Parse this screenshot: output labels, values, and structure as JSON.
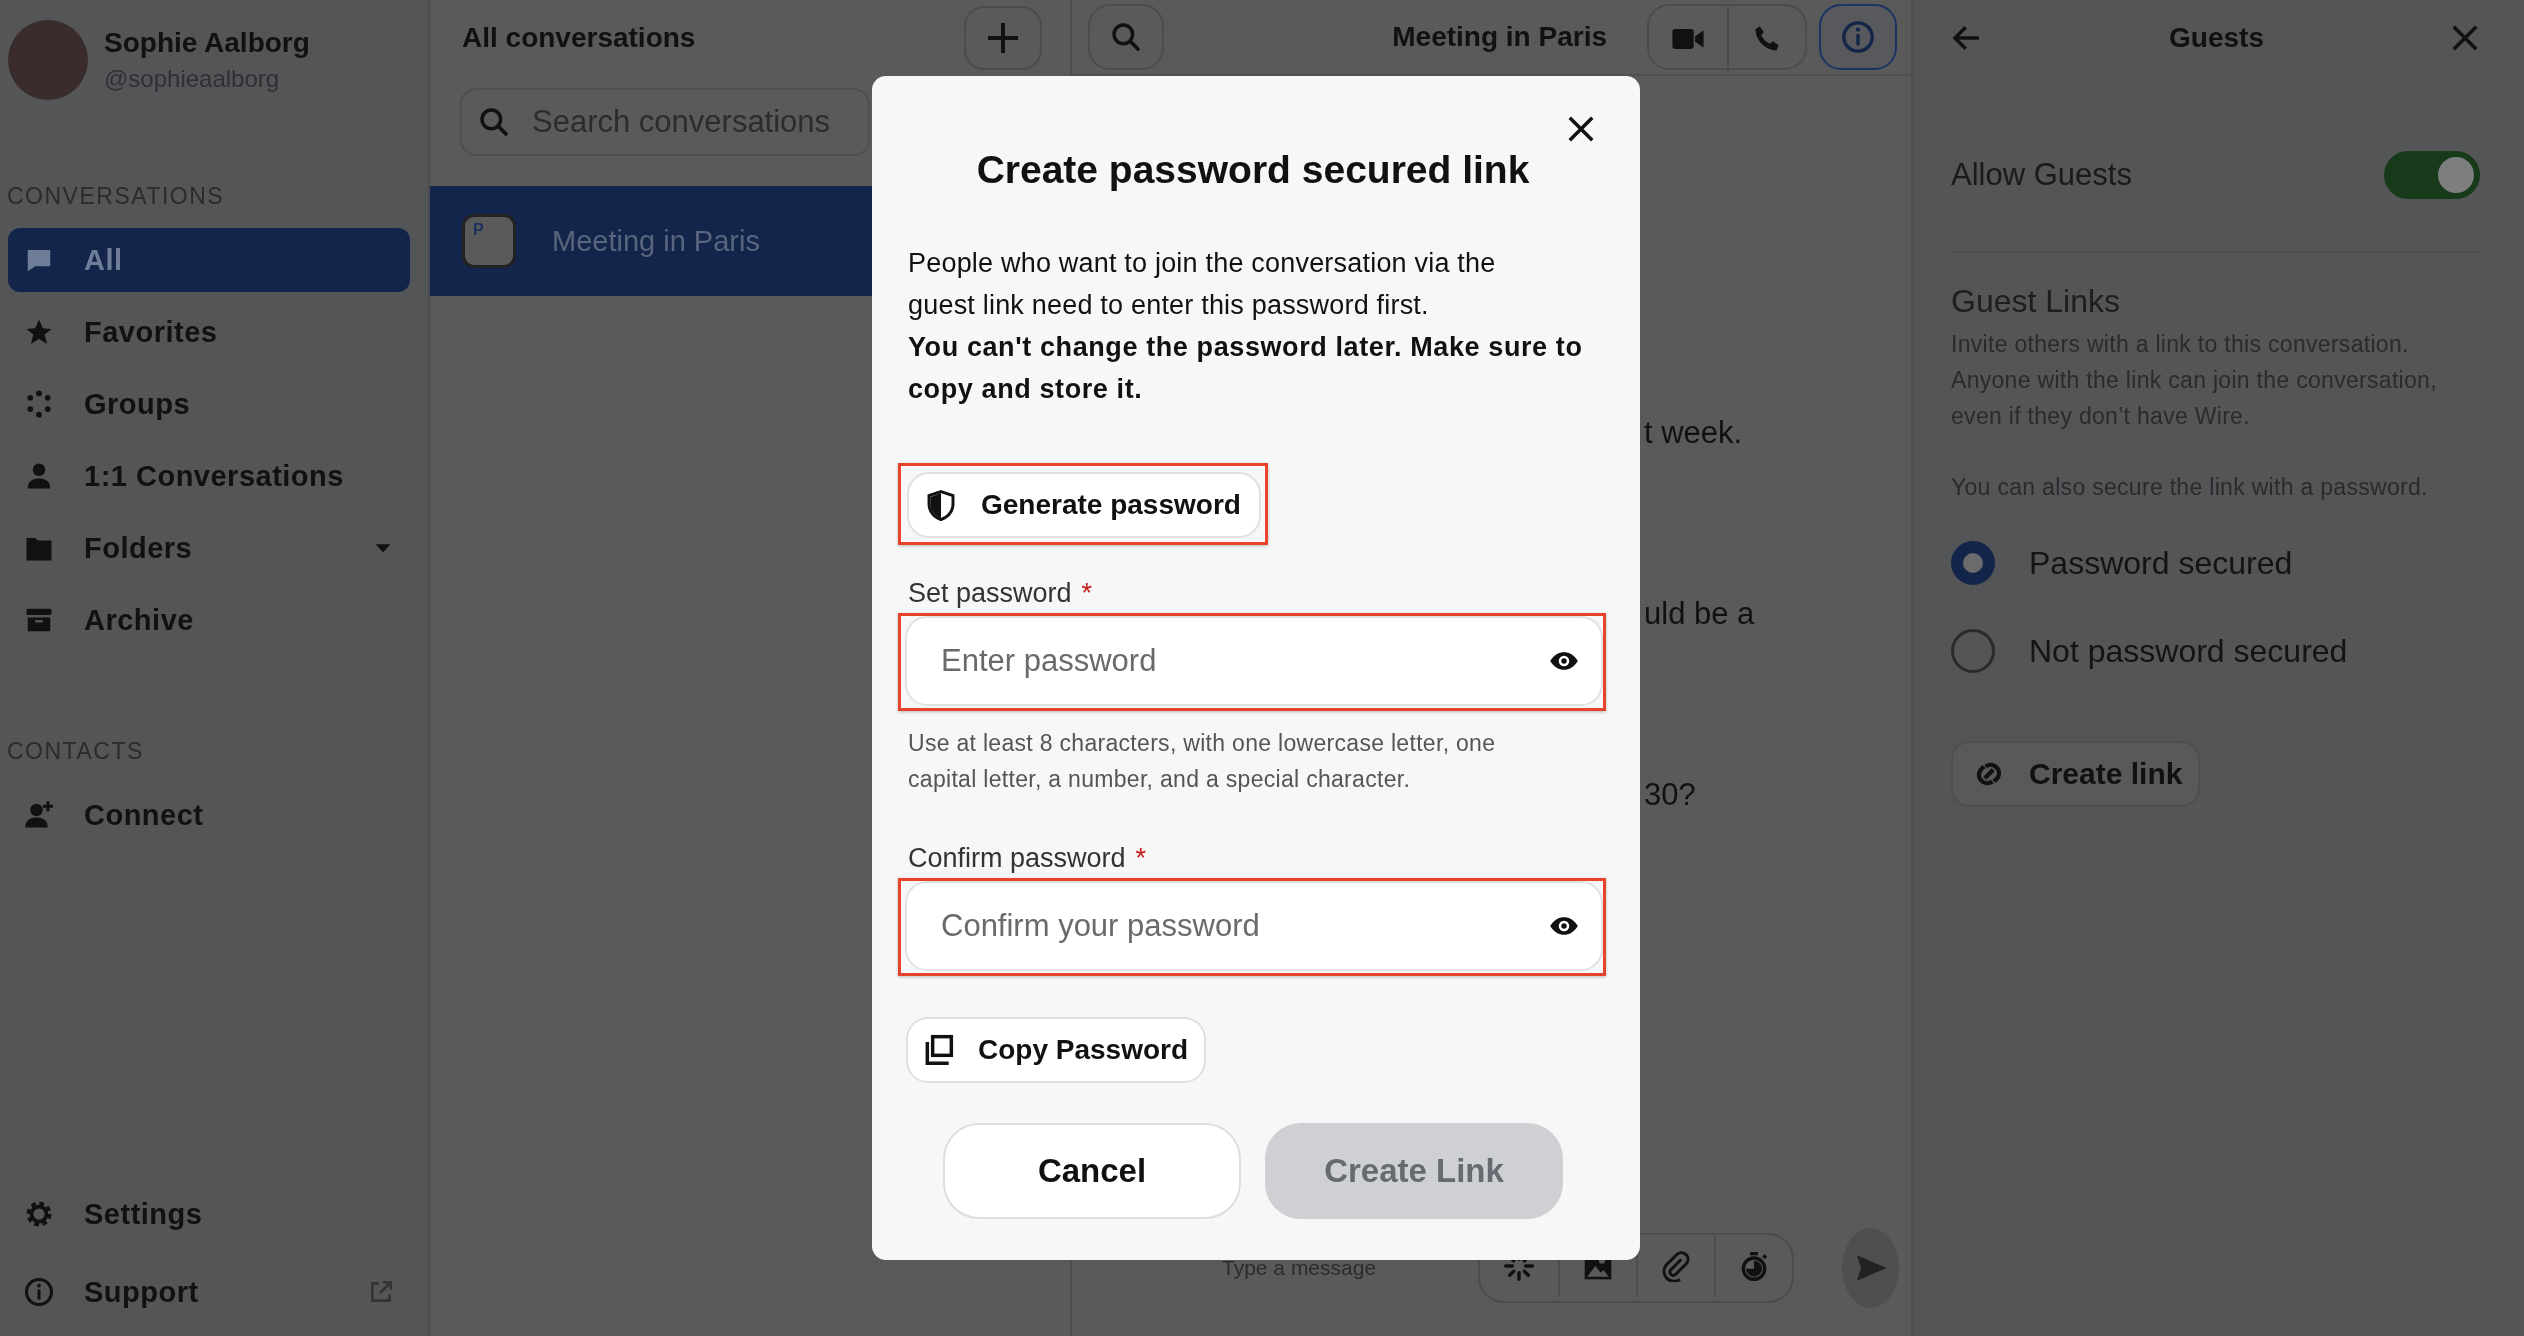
{
  "user": {
    "name": "Sophie Aalborg",
    "handle": "@sophieaalborg"
  },
  "sidebar": {
    "sections": [
      {
        "heading": "CONVERSATIONS",
        "items": [
          {
            "label": "All",
            "selected": true
          },
          {
            "label": "Favorites",
            "selected": false
          },
          {
            "label": "Groups",
            "selected": false
          },
          {
            "label": "1:1 Conversations",
            "selected": false
          },
          {
            "label": "Folders",
            "selected": false
          },
          {
            "label": "Archive",
            "selected": false
          }
        ]
      },
      {
        "heading": "CONTACTS",
        "items": [
          {
            "label": "Connect",
            "selected": false
          }
        ]
      }
    ],
    "footer": [
      {
        "label": "Settings"
      },
      {
        "label": "Support"
      }
    ]
  },
  "conversations": {
    "title": "All conversations",
    "search": {
      "placeholder": "Search conversations"
    },
    "items": [
      {
        "initial": "P",
        "name": "Meeting in Paris",
        "selected": true
      }
    ]
  },
  "chat": {
    "title": "Meeting in Paris",
    "messages": [
      "t week.",
      "uld be a",
      "30?"
    ],
    "composer": {
      "placeholder": "Type a message"
    }
  },
  "guests": {
    "title": "Guests",
    "allow_guests": {
      "label": "Allow Guests",
      "on": true
    },
    "guest_links": {
      "heading": "Guest Links",
      "description": "Invite others with a link to this conversation. Anyone with the link can join the conversation, even if they don’t have Wire.",
      "password_note": "You can also secure the link with a password."
    },
    "options": [
      {
        "label": "Password secured",
        "selected": true
      },
      {
        "label": "Not password secured",
        "selected": false
      }
    ],
    "create_button": "Create link"
  },
  "dialog": {
    "title": "Create password secured link",
    "intro": "People who want to join the conversation via the guest link need to enter this password first.",
    "warning": "You can't change the password later. Make sure to copy and store it.",
    "generate_button": {
      "label": "Generate password",
      "highlighted": true
    },
    "fields": [
      {
        "label": "Set password",
        "required_mark": "*",
        "placeholder": "Enter password",
        "highlighted": true,
        "hint": "Use at least 8 characters, with one lowercase letter, one capital letter, a number, and a special character."
      },
      {
        "label": "Confirm password",
        "required_mark": "*",
        "placeholder": "Confirm your password",
        "highlighted": true
      }
    ],
    "copy_button": "Copy Password",
    "buttons": [
      {
        "label": "Cancel",
        "disabled": false
      },
      {
        "label": "Create Link",
        "disabled": true
      }
    ]
  }
}
